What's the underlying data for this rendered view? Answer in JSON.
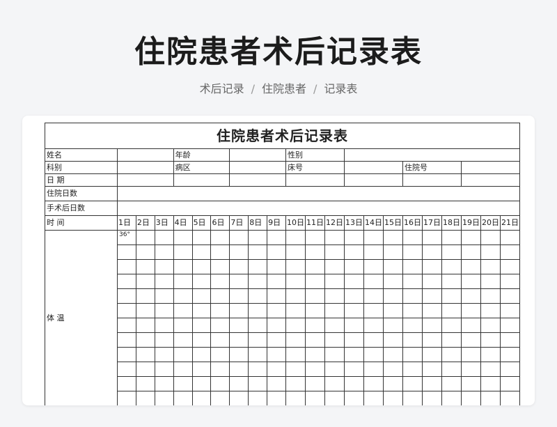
{
  "page": {
    "title": "住院患者术后记录表",
    "breadcrumb": [
      "术后记录",
      "住院患者",
      "记录表"
    ]
  },
  "sheet": {
    "title": "住院患者术后记录表",
    "name_label": "姓名",
    "age_label": "年龄",
    "gender_label": "性别",
    "dept_label": "科别",
    "ward_label": "病区",
    "bed_label": "床号",
    "admission_no_label": "住院号",
    "date_label": "日  期",
    "hospital_days_label": "住院日数",
    "postop_days_label": "手术后日数",
    "time_label": "时  间",
    "temperature_label": "体  温",
    "temp_mark": "36°",
    "days": [
      "1日",
      "2日",
      "3日",
      "4日",
      "5日",
      "6日",
      "7日",
      "8日",
      "9日",
      "10日",
      "11日",
      "12日",
      "13日",
      "14日",
      "15日",
      "16日",
      "17日",
      "18日",
      "19日",
      "20日",
      "21日"
    ]
  }
}
